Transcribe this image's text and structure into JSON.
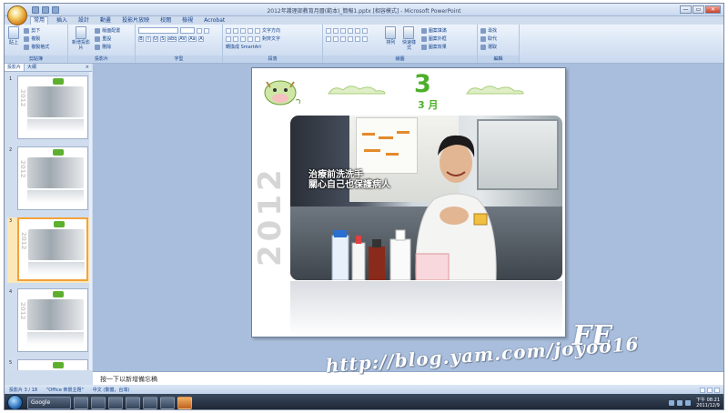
{
  "window": {
    "title": "2012年護理部教育月曆(範本)_簡報1.pptx [相容模式] - Microsoft PowerPoint",
    "controls": [
      "—",
      "▭",
      "✕"
    ]
  },
  "tabs": [
    "常用",
    "插入",
    "設計",
    "動畫",
    "投影片放映",
    "校閱",
    "檢視",
    "Acrobat"
  ],
  "active_tab": "常用",
  "ribbon": {
    "groups": [
      {
        "label": "剪貼簿",
        "big": "貼上",
        "items": [
          "剪下",
          "複製",
          "複製格式"
        ]
      },
      {
        "label": "投影片",
        "big": "新增投影片",
        "items": [
          "版面配置",
          "重設",
          "刪除"
        ]
      },
      {
        "label": "字型",
        "items": [
          "B",
          "I",
          "U",
          "S",
          "abc",
          "AV",
          "Aa",
          "A"
        ]
      },
      {
        "label": "段落",
        "items": [
          "文字方向",
          "對齊文字",
          "轉換成 SmartArt"
        ]
      },
      {
        "label": "繪圖",
        "big": "排列",
        "big2": "快速樣式",
        "items": [
          "圖案填滿",
          "圖案外框",
          "圖案效果"
        ]
      },
      {
        "label": "編輯",
        "items": [
          "尋找",
          "取代",
          "選取"
        ]
      }
    ]
  },
  "panel": {
    "tabs": [
      "投影片",
      "大綱"
    ],
    "close": "×"
  },
  "thumbnails": [
    {
      "num": "1",
      "year": "2012",
      "selected": false
    },
    {
      "num": "2",
      "year": "2012",
      "selected": false
    },
    {
      "num": "3",
      "year": "2012",
      "selected": true
    },
    {
      "num": "4",
      "year": "2012",
      "selected": false
    },
    {
      "num": "5",
      "year": "2012",
      "selected": false
    }
  ],
  "slide": {
    "month_big": "3",
    "month_sub": "3 月",
    "year": "2012",
    "caption_line1": "治療前洗洗手",
    "caption_line2": "關心自己也保護病人"
  },
  "notes": {
    "text": "按一下以新增備忘稿"
  },
  "status": {
    "slide_pos": "投影片 3 / 18",
    "theme": "\"Office 佈景主題\"",
    "language": "中文 (繁體，台灣)"
  },
  "taskbar": {
    "google_label": "Google",
    "clock_time": "下午 08:21",
    "clock_date": "2011/12/9"
  },
  "watermark": {
    "url": "http://blog.yam.com/joyoo16",
    "fe": "FE"
  },
  "colors": {
    "accent_green": "#4caf2a",
    "selection": "#f2a33a",
    "ribbon": "#d6e3f4"
  }
}
